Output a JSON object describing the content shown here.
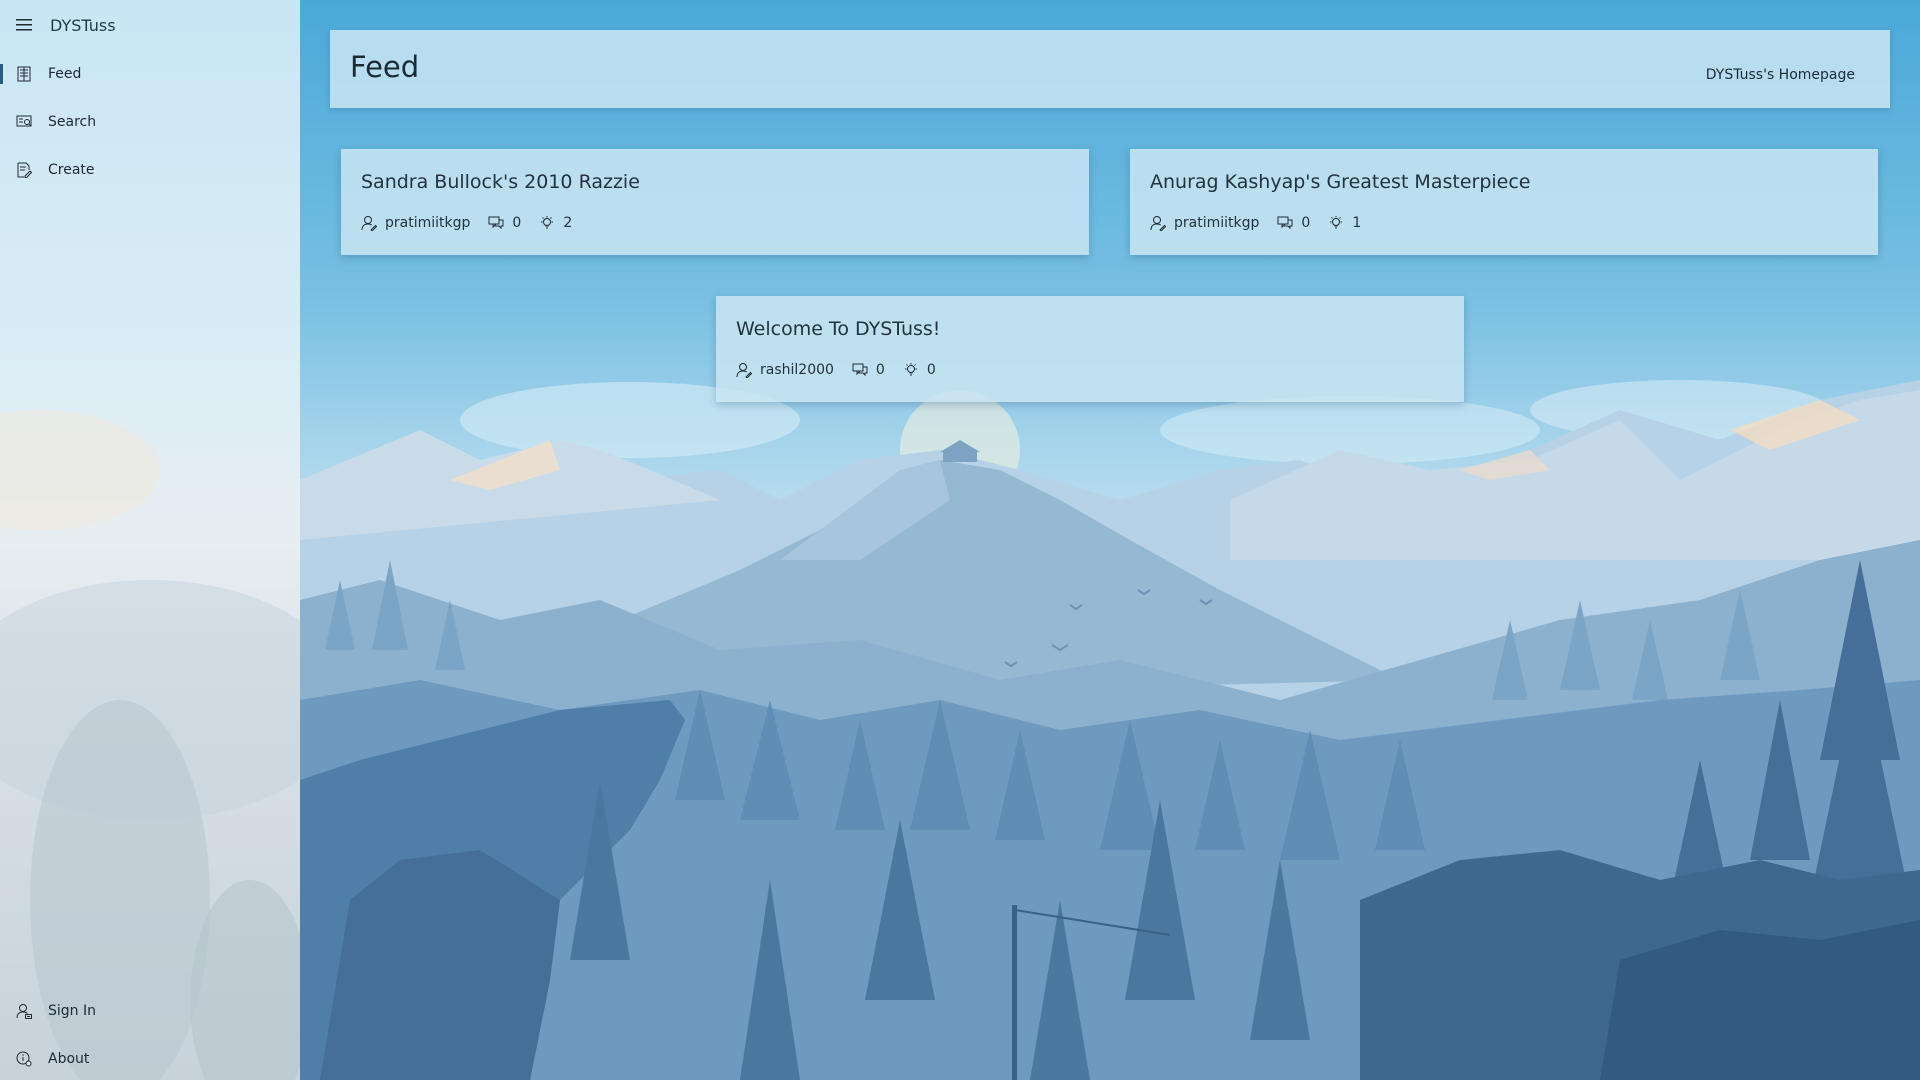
{
  "app": {
    "title": "DYSTuss"
  },
  "sidebar": {
    "top_items": [
      {
        "label": "Feed",
        "icon": "feed-icon",
        "active": true
      },
      {
        "label": "Search",
        "icon": "search-icon",
        "active": false
      },
      {
        "label": "Create",
        "icon": "create-icon",
        "active": false
      }
    ],
    "bottom_items": [
      {
        "label": "Sign In",
        "icon": "sign-in-icon"
      },
      {
        "label": "About",
        "icon": "about-icon"
      }
    ]
  },
  "header": {
    "title": "Feed",
    "homepage_label": "DYSTuss's Homepage"
  },
  "posts": [
    {
      "title": "Sandra Bullock's 2010 Razzie",
      "author": "pratimiitkgp",
      "comments": "0",
      "likes": "2"
    },
    {
      "title": "Anurag Kashyap's Greatest Masterpiece",
      "author": "pratimiitkgp",
      "comments": "0",
      "likes": "1"
    },
    {
      "title": "Welcome To DYSTuss!",
      "author": "rashil2000",
      "comments": "0",
      "likes": "0"
    }
  ],
  "colors": {
    "sky_top": "#4aa9d8",
    "card_background": "#c8e4f2",
    "active_indicator": "#2a5a80"
  }
}
